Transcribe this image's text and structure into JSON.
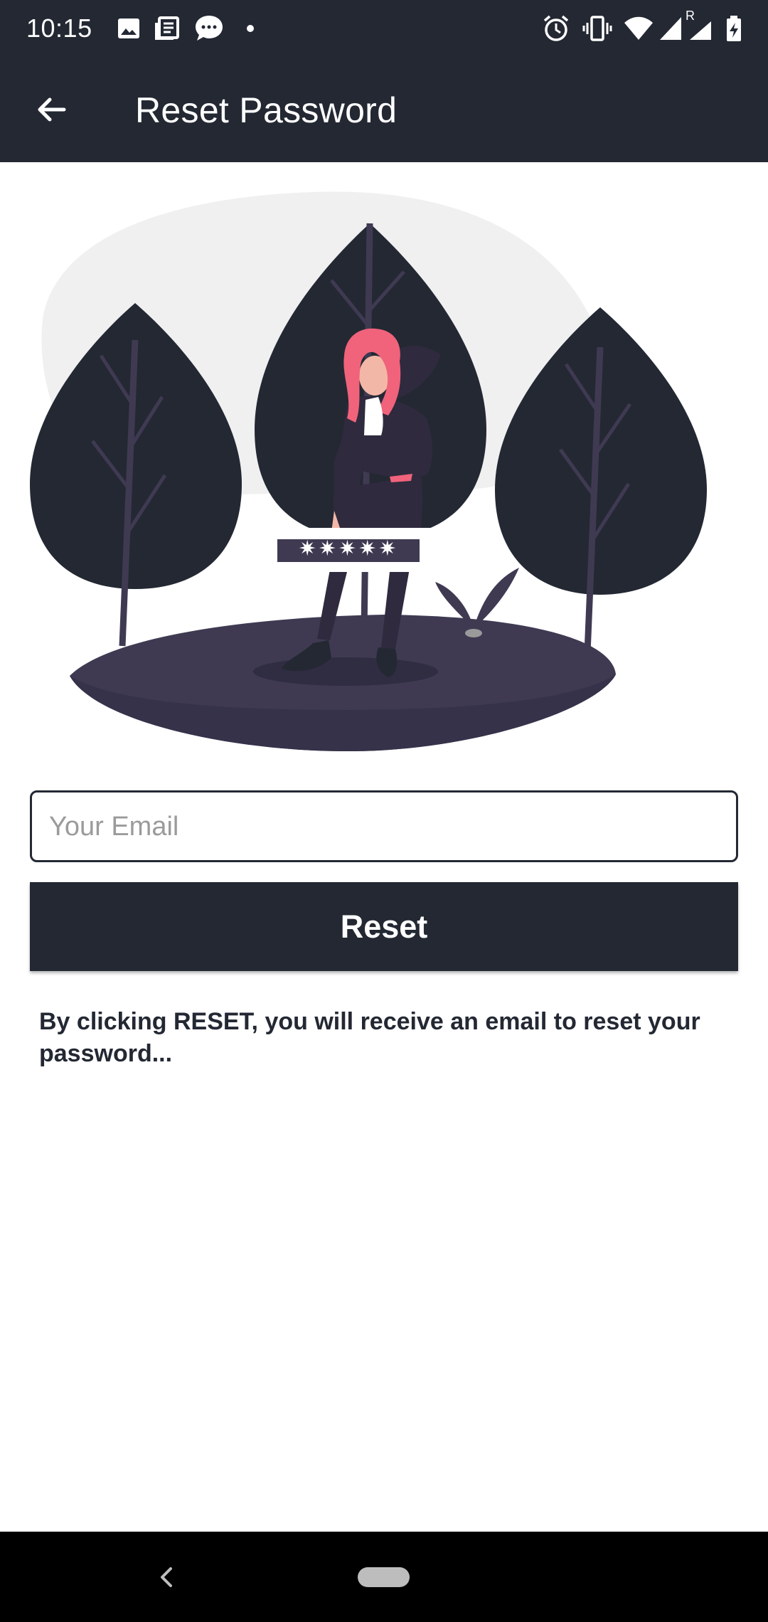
{
  "status_bar": {
    "time": "10:15",
    "left_icons": [
      "image-icon",
      "news-icon",
      "chat-bubble-icon",
      "dot-icon"
    ],
    "right_icons": [
      "alarm-icon",
      "vibrate-icon",
      "wifi-icon",
      "signal-icon",
      "signal-roaming-icon",
      "battery-charging-icon"
    ],
    "roaming_label": "R"
  },
  "app_bar": {
    "title": "Reset Password",
    "back_icon": "arrow-left-icon"
  },
  "illustration": {
    "password_mask": "✷✷✷✷✷",
    "description_icon": "woman-with-password-illustration"
  },
  "form": {
    "email_placeholder": "Your Email",
    "email_value": "",
    "reset_label": "Reset",
    "info_text": "By clicking RESET, you will receive an email to reset your password..."
  },
  "nav_bar": {
    "back_icon": "nav-back-icon",
    "home_icon": "nav-home-pill"
  },
  "colors": {
    "primary": "#232833",
    "tree": "#232833",
    "ground": "#3f3a52",
    "hair": "#f0637b",
    "background_blob": "#f0f0f0"
  }
}
